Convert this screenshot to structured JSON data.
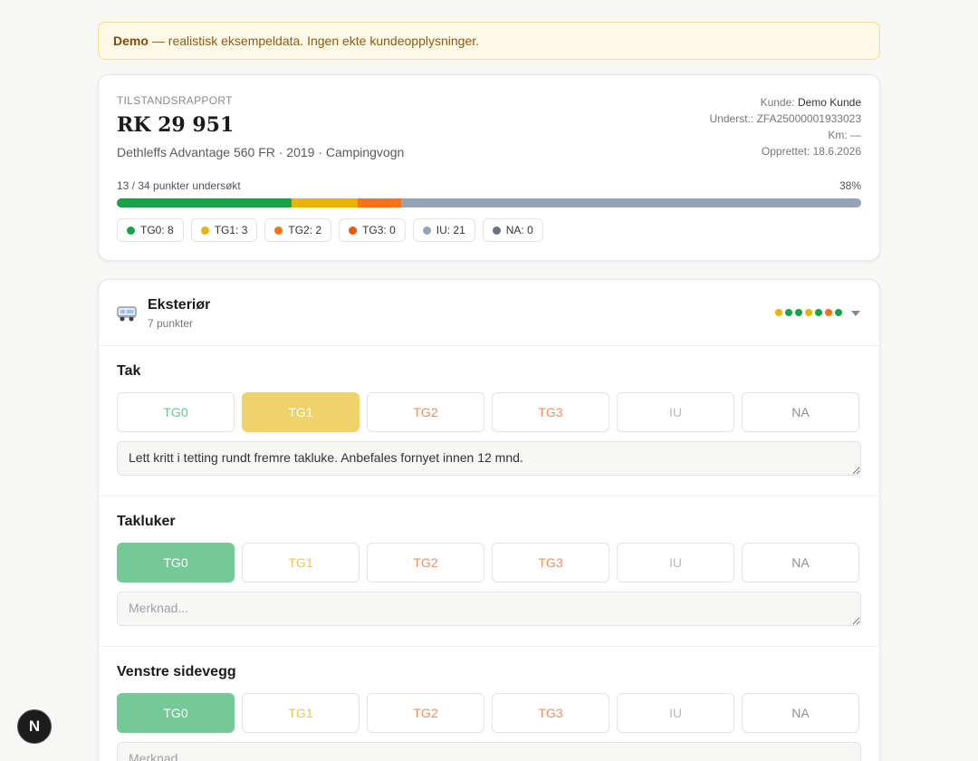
{
  "banner": {
    "strong": "Demo",
    "text": "— realistisk eksempeldata. Ingen ekte kundeopplysninger."
  },
  "report": {
    "kicker": "TILSTANDSRAPPORT",
    "plate": "RK 29 951",
    "description": "Dethleffs Advantage 560 FR · 2019 · Campingvogn",
    "meta": {
      "customer_label": "Kunde:",
      "customer": "Demo Kunde",
      "inspect_label": "Underst.:",
      "inspect": "ZFA25000001933023",
      "km_label": "Km:",
      "km": "—",
      "created_label": "Opprettet:",
      "created": "18.6.2026"
    },
    "progress_label": "13 / 34 punkter undersøkt",
    "progress_percent": "38%",
    "progress_fraction": 0.38,
    "segments": [
      {
        "key": "TG0",
        "count": 8,
        "color": "#16a34a"
      },
      {
        "key": "TG1",
        "count": 3,
        "color": "#eab308"
      },
      {
        "key": "TG2",
        "count": 2,
        "color": "#f97316"
      },
      {
        "key": "TG3",
        "count": 0,
        "color": "#ea580c"
      },
      {
        "key": "IU",
        "count": 21,
        "color": "#94a3b8"
      }
    ],
    "chips": [
      {
        "label": "TG0: 8",
        "color": "#16a34a"
      },
      {
        "label": "TG1: 3",
        "color": "#eab308"
      },
      {
        "label": "TG2: 2",
        "color": "#f97316"
      },
      {
        "label": "TG3: 0",
        "color": "#ea580c"
      },
      {
        "label": "IU: 21",
        "color": "#94a3b8"
      },
      {
        "label": "NA: 0",
        "color": "#6b7280"
      }
    ]
  },
  "section": {
    "title": "Eksteriør",
    "subtitle": "7 punkter",
    "status_colors": [
      "#eab308",
      "#16a34a",
      "#16a34a",
      "#eab308",
      "#16a34a",
      "#f97316",
      "#16a34a"
    ],
    "grade_labels": [
      "TG0",
      "TG1",
      "TG2",
      "TG3",
      "IU",
      "NA"
    ],
    "items": [
      {
        "name": "Tak",
        "selected": "TG1",
        "note": "Lett kritt i tetting rundt fremre takluke. Anbefales fornyet innen 12 mnd.",
        "placeholder": "Merknad..."
      },
      {
        "name": "Takluker",
        "selected": "TG0",
        "note": "",
        "placeholder": "Merknad..."
      },
      {
        "name": "Venstre sidevegg",
        "selected": "TG0",
        "note": "",
        "placeholder": "Merknad..."
      }
    ]
  },
  "next_badge": "N"
}
